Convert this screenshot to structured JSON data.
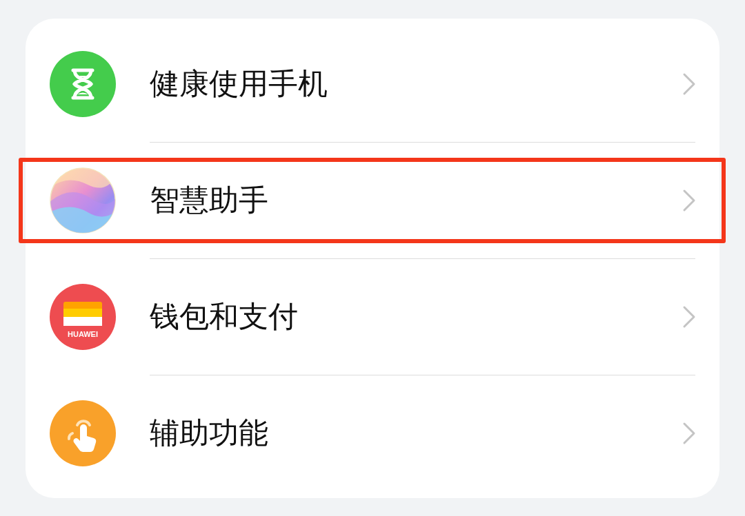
{
  "settings_list": [
    {
      "label": "健康使用手机",
      "kind": "hourglass",
      "highlighted": false
    },
    {
      "label": "智慧助手",
      "kind": "assistant",
      "highlighted": true
    },
    {
      "label": "钱包和支付",
      "kind": "wallet",
      "icon_text": "HUAWEI",
      "highlighted": false
    },
    {
      "label": "辅助功能",
      "kind": "touch",
      "highlighted": false
    }
  ]
}
